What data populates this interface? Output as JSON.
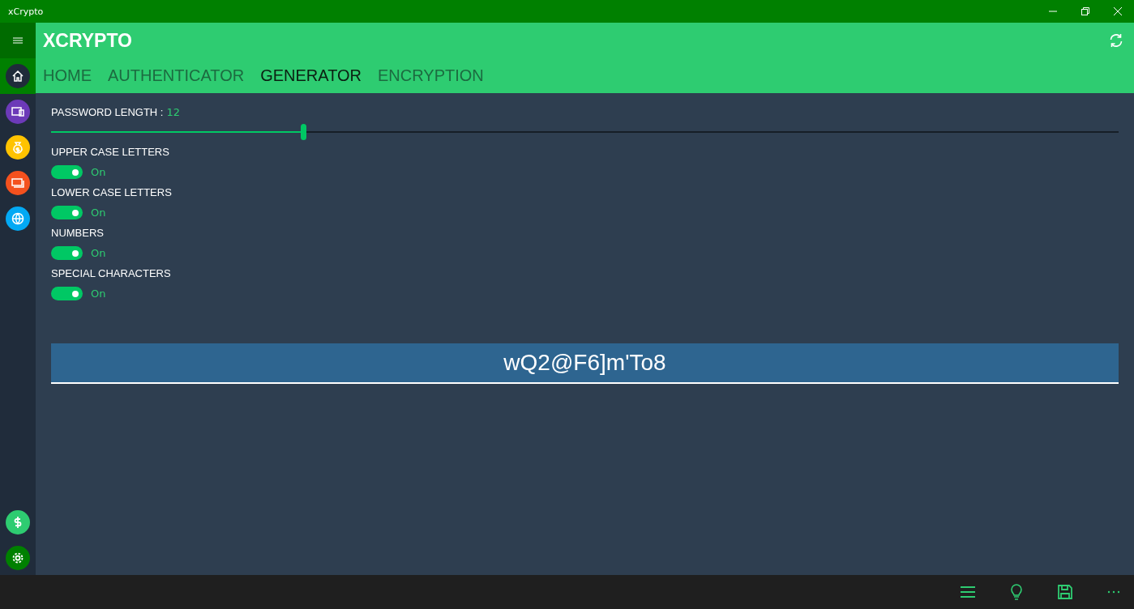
{
  "window": {
    "title": "xCrypto"
  },
  "app_title": "XCRYPTO",
  "tabs": [
    {
      "label": "HOME",
      "selected": false
    },
    {
      "label": "AUTHENTICATOR",
      "selected": false
    },
    {
      "label": "GENERATOR",
      "selected": true
    },
    {
      "label": "ENCRYPTION",
      "selected": false
    }
  ],
  "sidebar": {
    "items": [
      {
        "kind": "home",
        "color": "#1f2b3a",
        "selected": true
      },
      {
        "kind": "devices",
        "color": "#6c3ab8",
        "selected": false
      },
      {
        "kind": "money",
        "color": "#ffc300",
        "selected": false
      },
      {
        "kind": "cards",
        "color": "#f4511e",
        "selected": false
      },
      {
        "kind": "web",
        "color": "#03a9f4",
        "selected": false
      }
    ],
    "bottom_items": [
      {
        "kind": "dollar",
        "color": "#2ecc71"
      },
      {
        "kind": "settings",
        "color": "#008000"
      }
    ]
  },
  "length": {
    "label": "PASSWORD LENGTH :",
    "value": "12",
    "level": 0.236
  },
  "options": [
    {
      "label": "UPPER CASE LETTERS",
      "on": true,
      "state_text": "On"
    },
    {
      "label": "LOWER CASE LETTERS",
      "on": true,
      "state_text": "On"
    },
    {
      "label": "NUMBERS",
      "on": true,
      "state_text": "On"
    },
    {
      "label": "SPECIAL CHARACTERS",
      "on": true,
      "state_text": "On"
    }
  ],
  "password": "wQ2@F6]m'To8"
}
